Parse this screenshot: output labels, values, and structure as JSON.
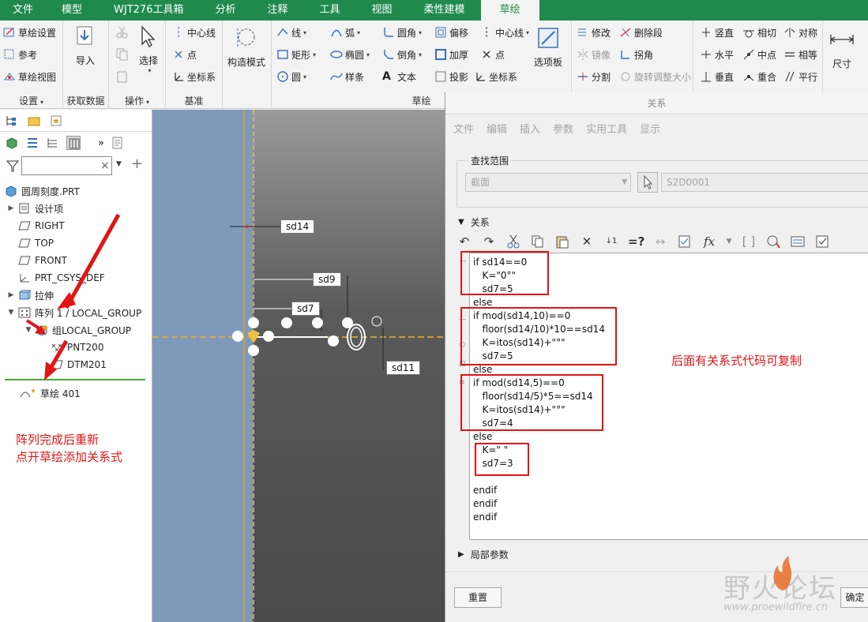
{
  "menu_tabs": [
    "文件",
    "模型",
    "WJT276工具箱",
    "分析",
    "注释",
    "工具",
    "视图",
    "柔性建模",
    "草绘"
  ],
  "menu_active_index": 8,
  "ribbon": {
    "setup": {
      "items": [
        "草绘设置",
        "参考",
        "草绘视图"
      ],
      "label": "设置",
      "dropdown": "▾"
    },
    "get_data": {
      "import": "导入",
      "label": "获取数据"
    },
    "operations": {
      "select": "选择",
      "label": "操作",
      "dropdown": "▾"
    },
    "datum": {
      "items": [
        "中心线",
        "点",
        "坐标系"
      ],
      "label": "基准"
    },
    "construction": {
      "label": "构造模式"
    },
    "sketch": {
      "col1": [
        "线",
        "矩形",
        "圆"
      ],
      "col2": [
        "弧",
        "椭圆",
        "样条"
      ],
      "col3": [
        "圆角",
        "倒角",
        "文本"
      ],
      "col4": [
        "偏移",
        "加厚",
        "投影"
      ],
      "col5": [
        "中心线",
        "点",
        "坐标系"
      ],
      "palette": "选项板",
      "label": "草绘"
    },
    "editing": {
      "items": [
        "修改",
        "删除段",
        "镜像",
        "拐角",
        "分割",
        "旋转调整大小"
      ]
    },
    "constrain": {
      "items": [
        "竖直",
        "相切",
        "对称",
        "水平",
        "中点",
        "相等",
        "垂直",
        "重合",
        "平行"
      ]
    },
    "dimension": {
      "label": "尺寸"
    }
  },
  "left_panel": {
    "search_clear": "×",
    "tree": [
      {
        "label": "圆周刻度.PRT",
        "icon": "part-icon",
        "expander": ""
      },
      {
        "label": "设计项",
        "icon": "design-items-icon",
        "expander": "▶"
      },
      {
        "label": "RIGHT",
        "icon": "plane-icon",
        "expander": ""
      },
      {
        "label": "TOP",
        "icon": "plane-icon",
        "expander": ""
      },
      {
        "label": "FRONT",
        "icon": "plane-icon",
        "expander": ""
      },
      {
        "label": "PRT_CSYS_DEF",
        "icon": "csys-icon",
        "expander": ""
      },
      {
        "label": "拉伸",
        "icon": "extrude-icon",
        "expander": "▶"
      },
      {
        "label": "阵列 1 / LOCAL_GROUP",
        "icon": "pattern-icon",
        "expander": "▼"
      },
      {
        "label": "组LOCAL_GROUP",
        "icon": "group-icon",
        "expander": "▼"
      },
      {
        "label": "PNT200",
        "icon": "point-icon",
        "expander": ""
      },
      {
        "label": "DTM201",
        "icon": "plane-icon",
        "expander": ""
      },
      {
        "label": "草绘 401",
        "icon": "sketch-icon",
        "expander": ""
      }
    ]
  },
  "canvas": {
    "dims": [
      "sd14",
      "sd9",
      "sd7",
      "sd11"
    ]
  },
  "dialog": {
    "title": "关系",
    "menu": [
      "文件",
      "编辑",
      "插入",
      "参数",
      "实用工具",
      "显示"
    ],
    "scope_legend": "查找范围",
    "scope_value": "截面",
    "scope_id": "S2D0001",
    "relations_label": "关系",
    "code_lines": [
      "if sd14==0",
      "   K=\"0°\"",
      "   sd7=5",
      "else",
      "if mod(sd14,10)==0",
      "   floor(sd14/10)*10==sd14",
      "   K=itos(sd14)+\"°\"",
      "   sd7=5",
      "else",
      "if mod(sd14,5)==0",
      "   floor(sd14/5)*5==sd14",
      "   K=itos(sd14)+\"°\"",
      "   sd7=4",
      "else",
      "   K=\" \"",
      "   sd7=3",
      "",
      "endif",
      "endif",
      "endif"
    ],
    "local_params": "局部参数",
    "reset": "重置",
    "ok": "确定"
  },
  "annotations": {
    "left_note_1": "阵列完成后重新",
    "left_note_2": "点开草绘添加关系式",
    "right_note": "后面有关系式代码可复制"
  },
  "watermark": {
    "cn": "野火论坛",
    "url": "www.proewildfire.cn"
  },
  "colors": {
    "menubar": "#1f8a4c",
    "annotation": "#e21414"
  }
}
